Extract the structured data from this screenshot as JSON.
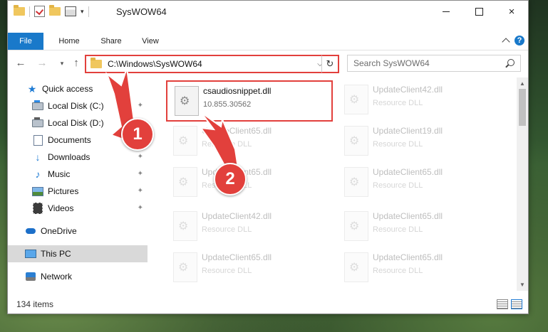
{
  "window": {
    "title": "SysWOW64",
    "controls": {
      "minimize": "minimize-icon",
      "maximize": "maximize-icon",
      "close": "×"
    }
  },
  "ribbon": {
    "tabs": [
      "File",
      "Home",
      "Share",
      "View"
    ],
    "help": "?"
  },
  "address": {
    "path": "C:\\Windows\\SysWOW64",
    "search_placeholder": "Search SysWOW64"
  },
  "nav": {
    "items": [
      {
        "label": "Quick access",
        "icon": "star-icon",
        "pinned": false
      },
      {
        "label": "Local Disk (C:)",
        "icon": "drive-icon",
        "pinned": true
      },
      {
        "label": "Local Disk (D:)",
        "icon": "drive-icon",
        "pinned": false
      },
      {
        "label": "Documents",
        "icon": "document-icon",
        "pinned": true
      },
      {
        "label": "Downloads",
        "icon": "download-icon",
        "pinned": true
      },
      {
        "label": "Music",
        "icon": "music-icon",
        "pinned": true
      },
      {
        "label": "Pictures",
        "icon": "picture-icon",
        "pinned": true
      },
      {
        "label": "Videos",
        "icon": "video-icon",
        "pinned": true
      },
      {
        "label": "OneDrive",
        "icon": "cloud-icon",
        "pinned": false
      },
      {
        "label": "This PC",
        "icon": "computer-icon",
        "pinned": false
      },
      {
        "label": "Network",
        "icon": "network-icon",
        "pinned": false
      }
    ]
  },
  "files": [
    {
      "name": "csaudiosnippet.dll",
      "desc": "10.855.30562"
    },
    {
      "name": "UpdateClient42.dll",
      "desc": "Resource DLL"
    },
    {
      "name": "UpdateClient65.dll",
      "desc": "Resource DLL"
    },
    {
      "name": "UpdateClient19.dll",
      "desc": "Resource DLL"
    },
    {
      "name": "UpdateClient65.dll",
      "desc": "Resource DLL"
    },
    {
      "name": "UpdateClient65.dll",
      "desc": "Resource DLL"
    },
    {
      "name": "UpdateClient42.dll",
      "desc": "Resource DLL"
    },
    {
      "name": "UpdateClient65.dll",
      "desc": "Resource DLL"
    },
    {
      "name": "UpdateClient65.dll",
      "desc": "Resource DLL"
    },
    {
      "name": "UpdateClient65.dll",
      "desc": "Resource DLL"
    }
  ],
  "status": {
    "count": "134 items"
  },
  "annotations": {
    "step1": "1",
    "step2": "2",
    "color": "#e2403c"
  }
}
